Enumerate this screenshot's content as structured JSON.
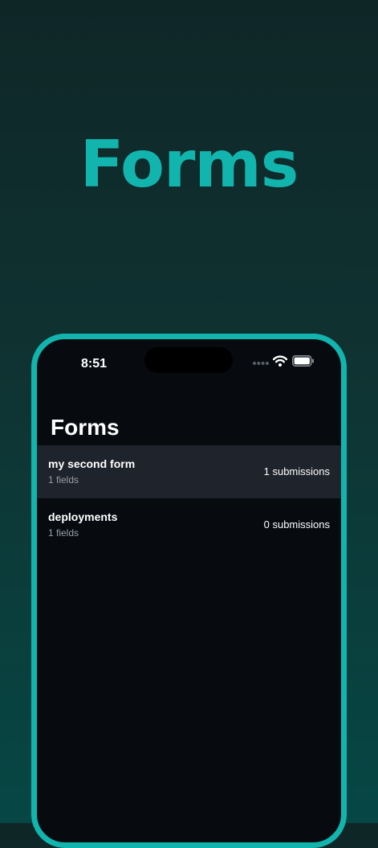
{
  "hero": {
    "title": "Forms",
    "title_color": "#12b5ae"
  },
  "status_bar": {
    "time": "8:51",
    "icons": [
      "signal-dots-icon",
      "wifi-icon",
      "battery-icon"
    ]
  },
  "screen": {
    "title": "Forms"
  },
  "forms": [
    {
      "name": "my second form",
      "fields": "1 fields",
      "submissions": "1 submissions",
      "selected": true
    },
    {
      "name": "deployments",
      "fields": "1 fields",
      "submissions": "0 submissions",
      "selected": false
    }
  ],
  "colors": {
    "accent": "#12b5ae",
    "screen_background": "#070b10",
    "selected_row": "#1f232b",
    "secondary_text": "#9aa0a8"
  }
}
